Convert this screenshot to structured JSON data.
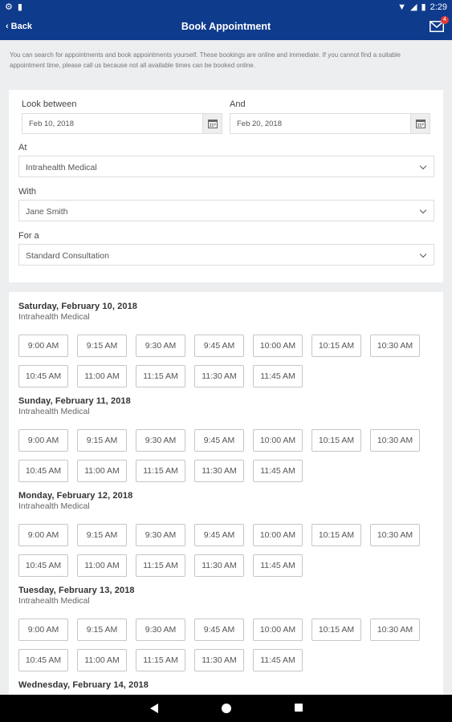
{
  "status": {
    "time": "2:29"
  },
  "appbar": {
    "back_label": "Back",
    "title": "Book Appointment",
    "badge": "4"
  },
  "intro": "You can search for appointments and book appointments yourself. These bookings are online and immediate. If you cannot find a suitable appointment time, please call us because not all available times can be booked online.",
  "form": {
    "look_between_label": "Look between",
    "and_label": "And",
    "start_date": "Feb 10, 2018",
    "end_date": "Feb 20, 2018",
    "at_label": "At",
    "at_value": "Intrahealth Medical",
    "with_label": "With",
    "with_value": "Jane Smith",
    "for_label": "For a",
    "for_value": "Standard Consultation"
  },
  "days": [
    {
      "title": "Saturday, February 10, 2018",
      "place": "Intrahealth Medical"
    },
    {
      "title": "Sunday, February 11, 2018",
      "place": "Intrahealth Medical"
    },
    {
      "title": "Monday, February 12, 2018",
      "place": "Intrahealth Medical"
    },
    {
      "title": "Tuesday, February 13, 2018",
      "place": "Intrahealth Medical"
    },
    {
      "title": "Wednesday, February 14, 2018",
      "place": ""
    }
  ],
  "times": [
    "9:00 AM",
    "9:15 AM",
    "9:30 AM",
    "9:45 AM",
    "10:00 AM",
    "10:15 AM",
    "10:30 AM",
    "10:45 AM",
    "11:00 AM",
    "11:15 AM",
    "11:30 AM",
    "11:45 AM"
  ]
}
